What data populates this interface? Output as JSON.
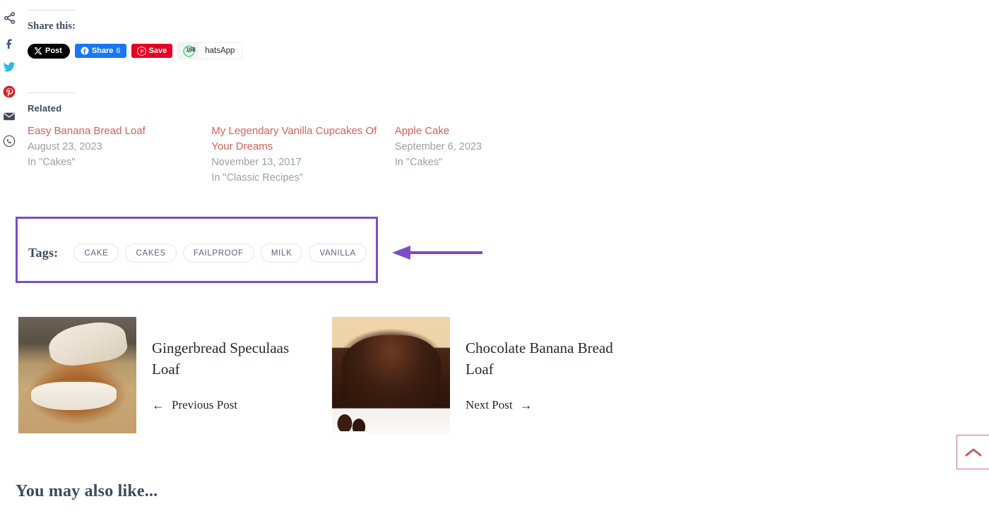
{
  "social_rail": {
    "icons": [
      {
        "name": "share-icon",
        "label": "Share"
      },
      {
        "name": "facebook-icon",
        "label": "Facebook"
      },
      {
        "name": "twitter-icon",
        "label": "Twitter"
      },
      {
        "name": "pinterest-icon",
        "label": "Pinterest"
      },
      {
        "name": "email-icon",
        "label": "Email"
      },
      {
        "name": "whatsapp-icon",
        "label": "WhatsApp"
      }
    ]
  },
  "share": {
    "heading": "Share this:",
    "buttons": [
      {
        "id": "x",
        "label": "Post",
        "count": "",
        "bg": "#000000"
      },
      {
        "id": "facebook",
        "label": "Share",
        "count": "6",
        "bg": "#1877f2"
      },
      {
        "id": "pinterest",
        "label": "Save",
        "count": "",
        "bg": "#e60023"
      },
      {
        "id": "whatsapp",
        "label": "hatsApp",
        "count": "168",
        "bg": "#f3f3f3"
      }
    ],
    "x_label": "Post",
    "fb_label": "Share",
    "fb_count": "6",
    "pin_label": "Save",
    "wa_label": "hatsApp",
    "wa_count": "168"
  },
  "related": {
    "heading": "Related",
    "posts": [
      {
        "title": "Easy Banana Bread Loaf",
        "date": "August 23, 2023",
        "category": "In \"Cakes\""
      },
      {
        "title": "My Legendary Vanilla Cupcakes Of Your Dreams",
        "date": "November 13, 2017",
        "category": "In \"Classic Recipes\""
      },
      {
        "title": "Apple Cake",
        "date": "September 6, 2023",
        "category": "In \"Cakes\""
      }
    ]
  },
  "tags": {
    "label": "Tags:",
    "items": [
      "CAKE",
      "CAKES",
      "FAILPROOF",
      "MILK",
      "VANILLA"
    ],
    "highlight_color": "#7c4dc4",
    "pill_border_color": "#f3dedd",
    "annotation": "arrow-pointing-left-at-tags"
  },
  "post_nav": {
    "previous": {
      "title": "Gingerbread Speculaas Loaf",
      "link_label": "Previous Post",
      "arrow": "←",
      "thumb_alt": "gingerbread-speculaas-loaf-thumbnail"
    },
    "next": {
      "title": "Chocolate Banana Bread Loaf",
      "link_label": "Next Post",
      "arrow": "→",
      "thumb_alt": "chocolate-banana-bread-loaf-thumbnail"
    }
  },
  "scroll_top": {
    "icon": "chevron-up-icon",
    "color": "#c9756e"
  },
  "also_like": {
    "heading": "You may also like..."
  }
}
